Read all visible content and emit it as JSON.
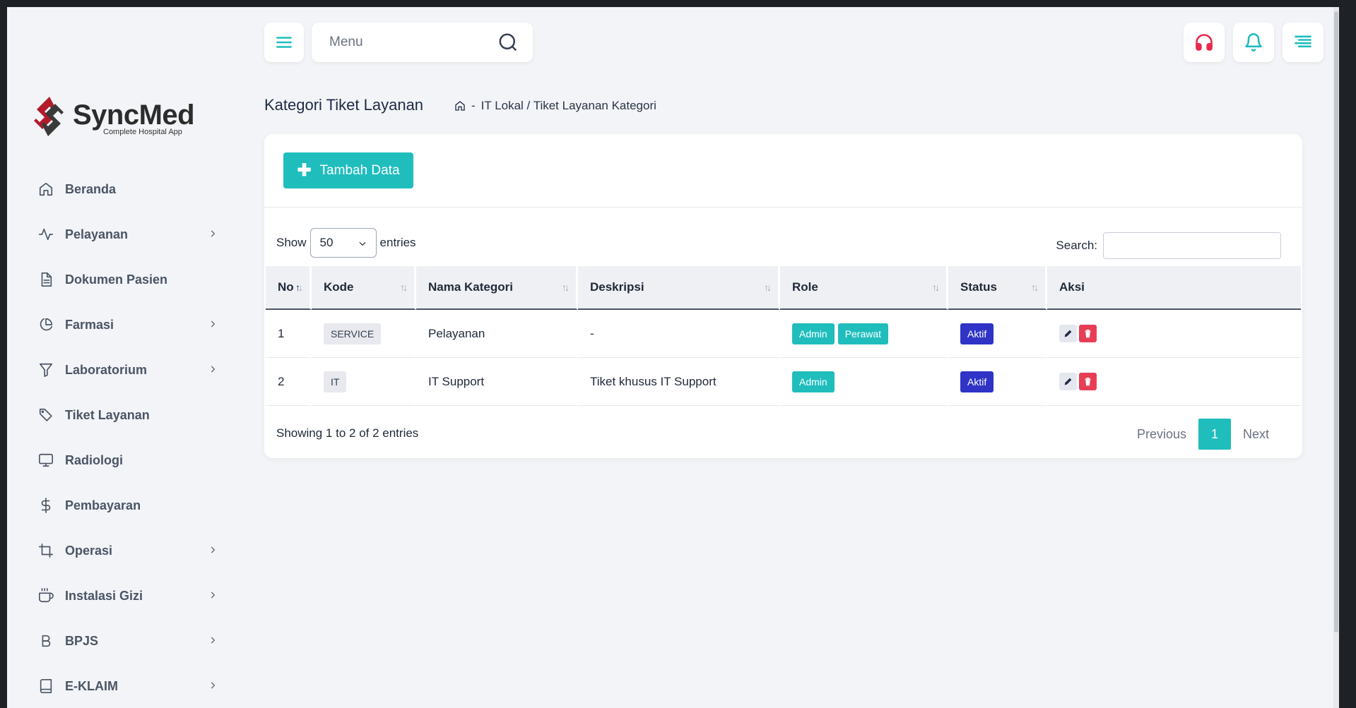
{
  "app": {
    "name": "SyncMed",
    "tagline": "Complete Hospital App",
    "brand_color": "#b31b2a",
    "accent_color": "#20bdbd"
  },
  "topbar": {
    "search_placeholder": "Menu",
    "icons": [
      "menu-icon",
      "search-icon",
      "headset-icon",
      "bell-icon",
      "align-right-icon"
    ]
  },
  "sidebar": {
    "items": [
      {
        "label": "Beranda",
        "icon": "home-icon",
        "has_submenu": false
      },
      {
        "label": "Pelayanan",
        "icon": "activity-icon",
        "has_submenu": true
      },
      {
        "label": "Dokumen Pasien",
        "icon": "file-icon",
        "has_submenu": false
      },
      {
        "label": "Farmasi",
        "icon": "pie-chart-icon",
        "has_submenu": true
      },
      {
        "label": "Laboratorium",
        "icon": "filter-icon",
        "has_submenu": true
      },
      {
        "label": "Tiket Layanan",
        "icon": "tag-icon",
        "has_submenu": false
      },
      {
        "label": "Radiologi",
        "icon": "monitor-icon",
        "has_submenu": false
      },
      {
        "label": "Pembayaran",
        "icon": "dollar-icon",
        "has_submenu": false
      },
      {
        "label": "Operasi",
        "icon": "crop-icon",
        "has_submenu": true
      },
      {
        "label": "Instalasi Gizi",
        "icon": "coffee-icon",
        "has_submenu": true
      },
      {
        "label": "BPJS",
        "icon": "bold-icon",
        "has_submenu": true
      },
      {
        "label": "E-KLAIM",
        "icon": "book-icon",
        "has_submenu": true
      }
    ]
  },
  "page": {
    "title": "Kategori Tiket Layanan",
    "breadcrumb_sep": "-",
    "breadcrumb": "IT Lokal / Tiket Layanan Kategori"
  },
  "toolbar": {
    "add_label": "Tambah Data"
  },
  "table_controls": {
    "show_label": "Show",
    "entries_value": "50",
    "entries_label": "entries",
    "search_label": "Search:",
    "search_value": ""
  },
  "table": {
    "headers": [
      "No",
      "Kode",
      "Nama Kategori",
      "Deskripsi",
      "Role",
      "Status",
      "Aksi"
    ],
    "rows": [
      {
        "no": "1",
        "kode": "SERVICE",
        "nama": "Pelayanan",
        "deskripsi": "-",
        "roles": [
          "Admin",
          "Perawat"
        ],
        "status": "Aktif"
      },
      {
        "no": "2",
        "kode": "IT",
        "nama": "IT Support",
        "deskripsi": "Tiket khusus IT Support",
        "roles": [
          "Admin"
        ],
        "status": "Aktif"
      }
    ]
  },
  "footer": {
    "info": "Showing 1 to 2 of 2 entries",
    "previous": "Previous",
    "current_page": "1",
    "next": "Next"
  }
}
